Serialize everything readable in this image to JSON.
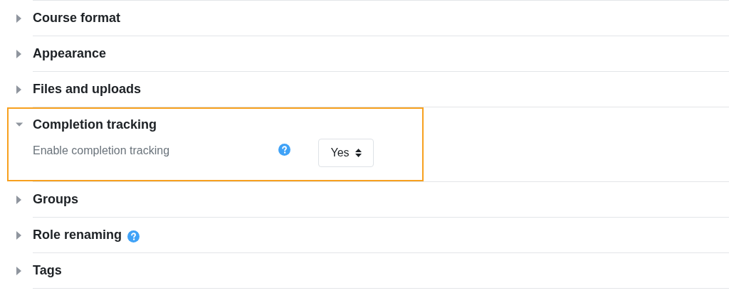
{
  "sections": [
    {
      "title": "Course format",
      "expanded": false,
      "highlighted": false,
      "help": false
    },
    {
      "title": "Appearance",
      "expanded": false,
      "highlighted": false,
      "help": false
    },
    {
      "title": "Files and uploads",
      "expanded": false,
      "highlighted": false,
      "help": false
    },
    {
      "title": "Completion tracking",
      "expanded": true,
      "highlighted": true,
      "help": false,
      "settings": [
        {
          "label": "Enable completion tracking",
          "help": true,
          "value": "Yes"
        }
      ]
    },
    {
      "title": "Groups",
      "expanded": false,
      "highlighted": false,
      "help": false
    },
    {
      "title": "Role renaming",
      "expanded": false,
      "highlighted": false,
      "help": true
    },
    {
      "title": "Tags",
      "expanded": false,
      "highlighted": false,
      "help": false
    }
  ]
}
